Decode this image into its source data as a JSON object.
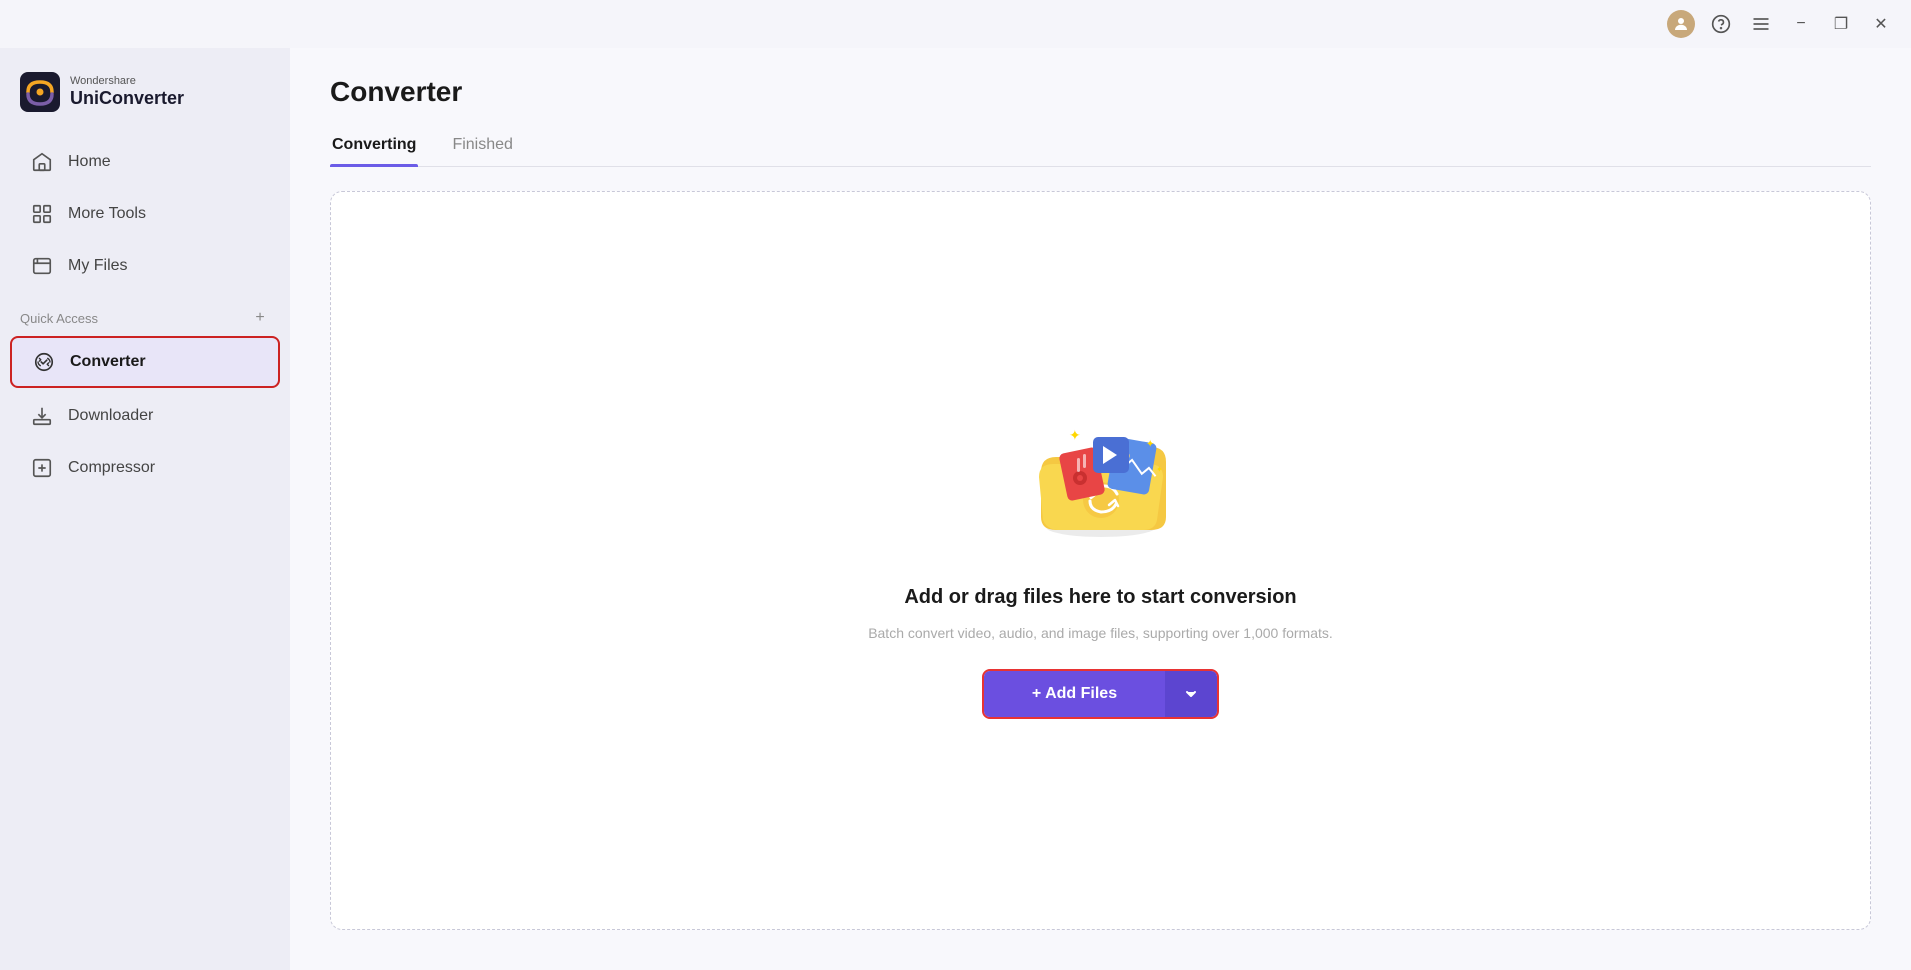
{
  "app": {
    "brand_top": "Wondershare",
    "brand_bottom": "UniConverter"
  },
  "titlebar": {
    "profile_icon": "👤",
    "support_label": "support",
    "menu_label": "menu",
    "minimize_label": "−",
    "restore_label": "❐",
    "close_label": "✕"
  },
  "sidebar": {
    "nav_items": [
      {
        "id": "home",
        "label": "Home",
        "icon": "home"
      },
      {
        "id": "more-tools",
        "label": "More Tools",
        "icon": "grid"
      },
      {
        "id": "my-files",
        "label": "My Files",
        "icon": "files"
      }
    ],
    "quick_access_label": "Quick Access",
    "quick_access_items": [
      {
        "id": "converter",
        "label": "Converter",
        "icon": "converter",
        "active": true
      },
      {
        "id": "downloader",
        "label": "Downloader",
        "icon": "downloader"
      },
      {
        "id": "compressor",
        "label": "Compressor",
        "icon": "compressor"
      }
    ]
  },
  "page": {
    "title": "Converter",
    "tabs": [
      {
        "id": "converting",
        "label": "Converting",
        "active": true
      },
      {
        "id": "finished",
        "label": "Finished",
        "active": false
      }
    ]
  },
  "dropzone": {
    "main_text": "Add or drag files here to start conversion",
    "sub_text": "Batch convert video, audio, and image files, supporting over 1,000 formats.",
    "add_files_label": "+ Add Files",
    "dropdown_arrow": "▾"
  }
}
